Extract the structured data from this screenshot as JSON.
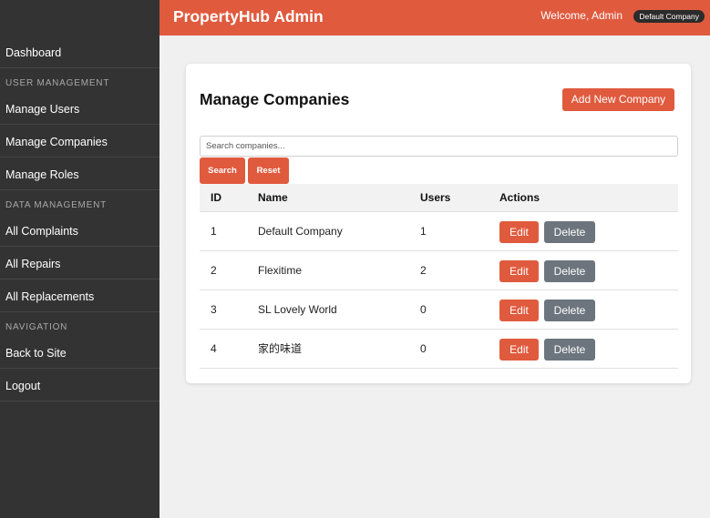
{
  "header": {
    "brand": "PropertyHub Admin",
    "welcome": "Welcome, Admin",
    "company_badge": "Default Company"
  },
  "sidebar": {
    "dashboard": "Dashboard",
    "user_management_heading": "USER MANAGEMENT",
    "manage_users": "Manage Users",
    "manage_companies": "Manage Companies",
    "manage_roles": "Manage Roles",
    "data_management_heading": "DATA MANAGEMENT",
    "all_complaints": "All Complaints",
    "all_repairs": "All Repairs",
    "all_replacements": "All Replacements",
    "navigation_heading": "NAVIGATION",
    "back_to_site": "Back to Site",
    "logout": "Logout"
  },
  "main": {
    "title": "Manage Companies",
    "add_button": "Add New Company",
    "search_placeholder": "Search companies...",
    "search_button": "Search",
    "reset_button": "Reset",
    "table": {
      "headers": {
        "id": "ID",
        "name": "Name",
        "users": "Users",
        "actions": "Actions"
      },
      "rows": [
        {
          "id": "1",
          "name": "Default Company",
          "users": "1"
        },
        {
          "id": "2",
          "name": "Flexitime",
          "users": "2"
        },
        {
          "id": "3",
          "name": "SL Lovely World",
          "users": "0"
        },
        {
          "id": "4",
          "name": "家的味道",
          "users": "0"
        }
      ],
      "edit_label": "Edit",
      "delete_label": "Delete"
    }
  },
  "colors": {
    "accent": "#e05a3e",
    "sidebar_bg": "#333333",
    "secondary_button": "#6c757d"
  }
}
